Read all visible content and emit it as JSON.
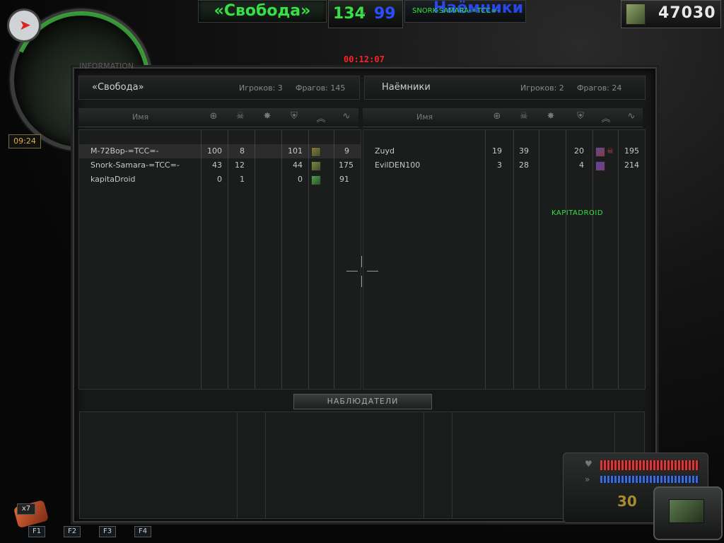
{
  "hud": {
    "team1_title": "«Свобода»",
    "score_team1": "134",
    "score_sep": "--",
    "score_team2": "99",
    "team2_title": "Наёмники",
    "local_player": "SNORK-SAMARA-=TCC=-",
    "money": "47030",
    "game_clock": "09:24",
    "round_timer": "00:12:07",
    "info_tab": "INFORMATION",
    "grenade_count": "x7",
    "fkeys": [
      "F1",
      "F2",
      "F3",
      "F4"
    ],
    "ammo": "30"
  },
  "teams": [
    {
      "name": "«Свобода»",
      "players_label": "Игроков: 3",
      "frags_label": "Фрагов: 145",
      "name_header": "Имя",
      "rows": [
        {
          "name": "M-72Bop-=TCC=-",
          "kills": "100",
          "deaths": "8",
          "col3": "",
          "score": "101",
          "ping": "9",
          "selected": true
        },
        {
          "name": "Snork-Samara-=TCC=-",
          "kills": "43",
          "deaths": "12",
          "col3": "",
          "score": "44",
          "ping": "175",
          "selected": false
        },
        {
          "name": "kapitaDroid",
          "kills": "0",
          "deaths": "1",
          "col3": "",
          "score": "0",
          "ping": "91",
          "selected": false
        }
      ]
    },
    {
      "name": "Наёмники",
      "players_label": "Игроков: 2",
      "frags_label": "Фрагов: 24",
      "name_header": "Имя",
      "rows": [
        {
          "name": "Zuyd",
          "kills": "19",
          "deaths": "39",
          "col3": "",
          "score": "20",
          "ping": "195",
          "selected": false
        },
        {
          "name": "EvilDEN100",
          "kills": "3",
          "deaths": "28",
          "col3": "",
          "score": "4",
          "ping": "214",
          "selected": false
        }
      ]
    }
  ],
  "column_icons": [
    "crosshair-icon",
    "skull-icon",
    "explosion-icon",
    "shield-icon",
    "rank-chevron-icon",
    "ping-wave-icon"
  ],
  "overlay_tag": "KAPITADROID",
  "spectators_label": "НАБЛЮДАТЕЛИ",
  "colors": {
    "green": "#37e046",
    "blue": "#2a4dff",
    "red": "#ff2222",
    "accent": "#e0b040"
  }
}
